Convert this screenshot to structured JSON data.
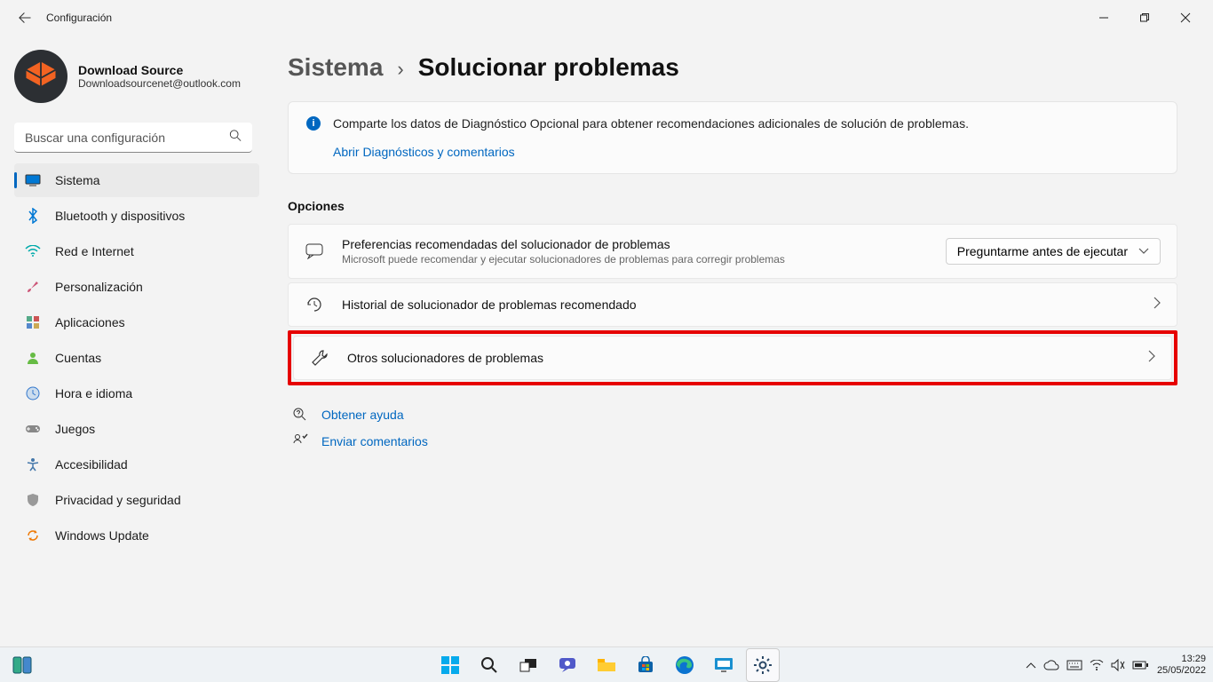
{
  "window": {
    "title": "Configuración"
  },
  "profile": {
    "name": "Download Source",
    "email": "Downloadsourcenet@outlook.com"
  },
  "search": {
    "placeholder": "Buscar una configuración"
  },
  "sidebar": {
    "items": [
      {
        "label": "Sistema"
      },
      {
        "label": "Bluetooth y dispositivos"
      },
      {
        "label": "Red e Internet"
      },
      {
        "label": "Personalización"
      },
      {
        "label": "Aplicaciones"
      },
      {
        "label": "Cuentas"
      },
      {
        "label": "Hora e idioma"
      },
      {
        "label": "Juegos"
      },
      {
        "label": "Accesibilidad"
      },
      {
        "label": "Privacidad y seguridad"
      },
      {
        "label": "Windows Update"
      }
    ]
  },
  "breadcrumb": {
    "parent": "Sistema",
    "current": "Solucionar problemas"
  },
  "info": {
    "text": "Comparte los datos de Diagnóstico Opcional para obtener recomendaciones adicionales de solución de problemas.",
    "link": "Abrir Diagnósticos y comentarios"
  },
  "section": {
    "options": "Opciones"
  },
  "prefs": {
    "title": "Preferencias recomendadas del solucionador de problemas",
    "subtitle": "Microsoft puede recomendar y ejecutar solucionadores de problemas para corregir problemas",
    "dropdown": "Preguntarme antes de ejecutar"
  },
  "history": {
    "title": "Historial de solucionador de problemas recomendado"
  },
  "other": {
    "title": "Otros solucionadores de problemas"
  },
  "help": {
    "get_help": "Obtener ayuda",
    "feedback": "Enviar comentarios"
  },
  "taskbar": {
    "time": "13:29",
    "date": "25/05/2022"
  }
}
